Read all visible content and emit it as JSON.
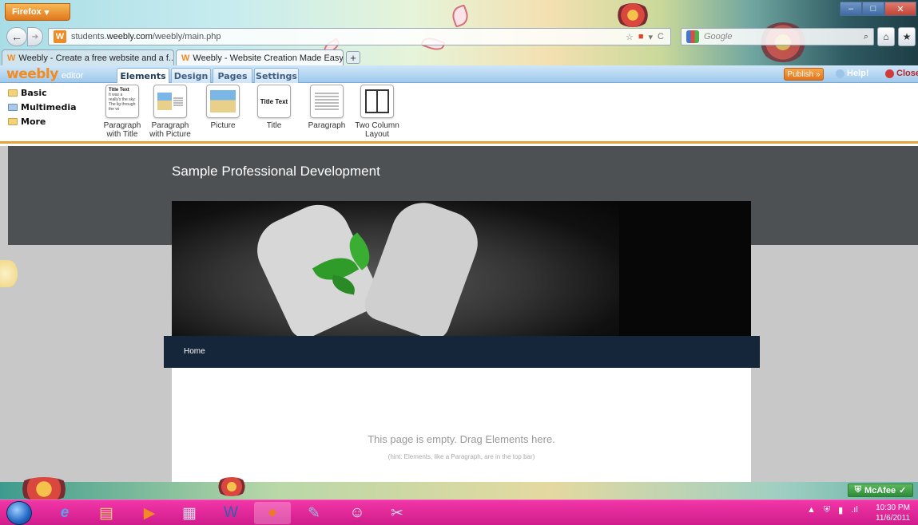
{
  "browser": {
    "firefox_button": "Firefox",
    "url_host": "students.",
    "url_domain": "weebly.com",
    "url_path": "/weebly/main.php",
    "search_placeholder": "Google",
    "tabs": [
      {
        "label": "Weebly - Create a free website and a f..."
      },
      {
        "label": "Weebly - Website Creation Made Easy"
      }
    ]
  },
  "weebly": {
    "logo": "weebly",
    "logo_sub": "editor",
    "tabs": [
      "Elements",
      "Design",
      "Pages",
      "Settings"
    ],
    "active_tab": "Elements",
    "publish": "Publish »",
    "help": "Help!",
    "close": "Close"
  },
  "elements": {
    "categories": [
      "Basic",
      "Multimedia",
      "More"
    ],
    "items": [
      {
        "label": "Paragraph\nwith Title",
        "thumb_title": "Title Text",
        "thumb_text": "It was a really's the sky. The lig through the wi"
      },
      {
        "label": "Paragraph\nwith Picture"
      },
      {
        "label": "Picture"
      },
      {
        "label": "Title",
        "thumb_title": "Title Text"
      },
      {
        "label": "Paragraph"
      },
      {
        "label": "Two Column\nLayout"
      }
    ]
  },
  "site": {
    "title": "Sample Professional Development",
    "nav": [
      "Home"
    ],
    "empty_message": "This page is empty. Drag Elements here.",
    "hint": "(hint: Elements, like a Paragraph, are in the top bar)"
  },
  "taskbar": {
    "mcafee": "McAfee",
    "time": "10:30 PM",
    "date": "11/6/2011"
  },
  "colors": {
    "accent_orange": "#e4a23a",
    "header_gray": "#4e5154",
    "nav_navy": "#15253a",
    "taskbar_pink": "#e0289a"
  }
}
